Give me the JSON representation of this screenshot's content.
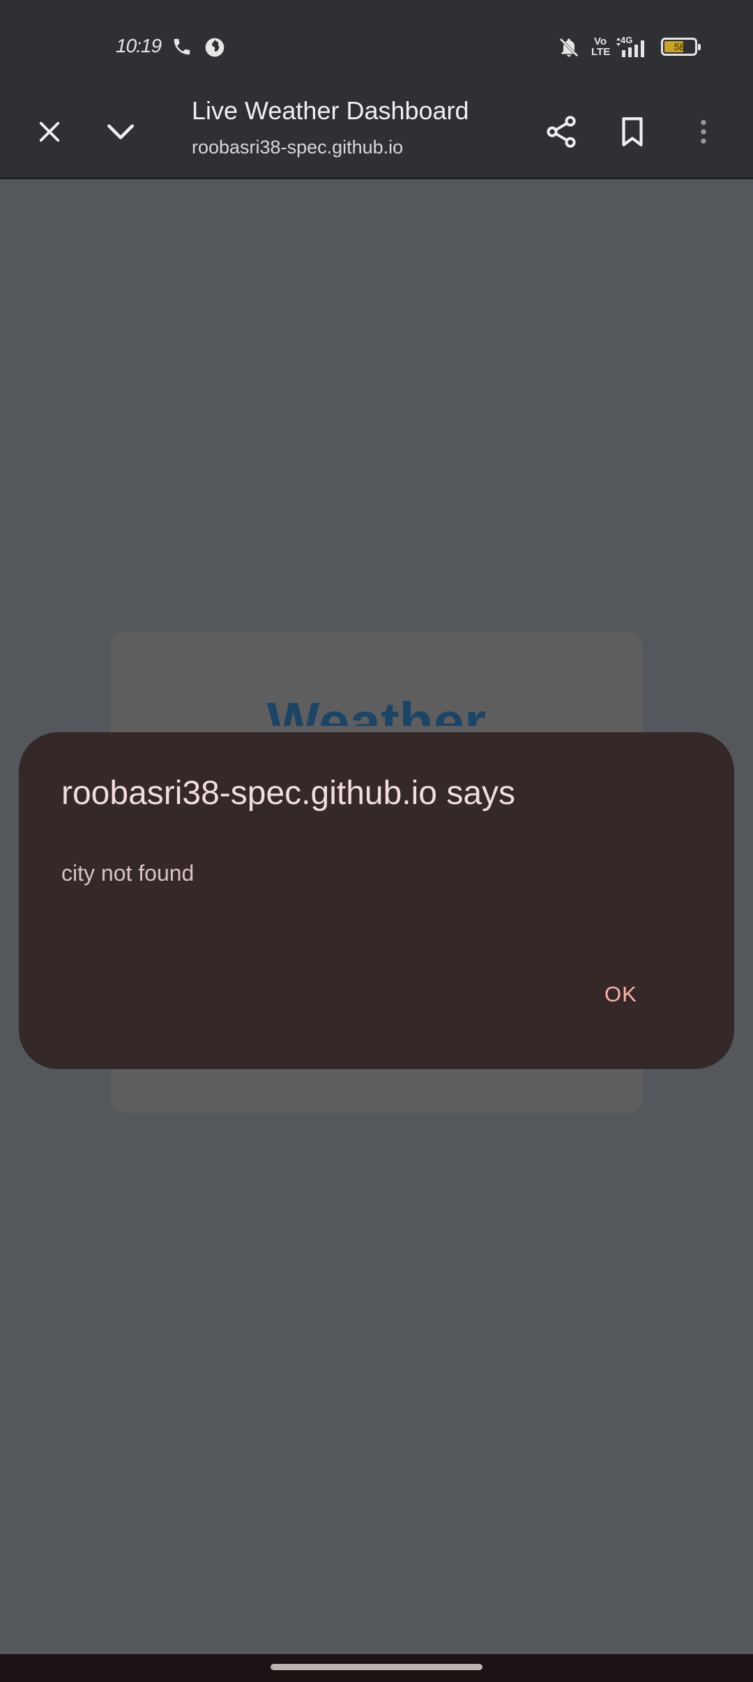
{
  "status_bar": {
    "time": "10:19",
    "battery_level": "58",
    "battery_fraction": 0.58,
    "network": "4G",
    "volte": "Vo LTE",
    "icons": [
      "phone-icon",
      "globe-icon",
      "bell-off-icon",
      "volte-icon",
      "signal-icon",
      "battery-icon"
    ]
  },
  "toolbar": {
    "title": "Live Weather Dashboard",
    "url": "roobasri38-spec.github.io",
    "icons": [
      "close-icon",
      "chevron-down-icon",
      "share-icon",
      "bookmark-icon",
      "more-vert-icon"
    ]
  },
  "page": {
    "card_heading": "Weather"
  },
  "dialog": {
    "title": "roobasri38-spec.github.io says",
    "message": "city not found",
    "ok_label": "OK"
  },
  "colors": {
    "background_dim": "#54585c",
    "toolbar": "#2f3034",
    "dialog_bg": "#342928",
    "ok_accent": "#ffb4a8",
    "heading_blue": "#1c4565"
  }
}
